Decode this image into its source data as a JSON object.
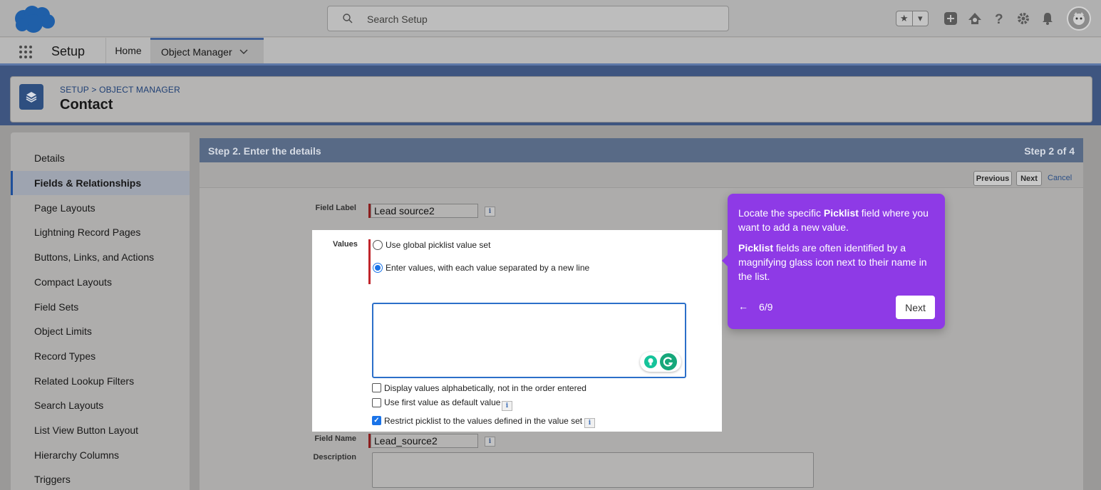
{
  "header": {
    "search_placeholder": "Search Setup",
    "star_glyph": "★",
    "dropdown_glyph": "▾"
  },
  "nav": {
    "app_name": "Setup",
    "tabs": [
      {
        "label": "Home"
      },
      {
        "label": "Object Manager"
      }
    ]
  },
  "object_header": {
    "breadcrumb": "SETUP > OBJECT MANAGER",
    "title": "Contact"
  },
  "sidebar": {
    "items": [
      {
        "label": "Details"
      },
      {
        "label": "Fields & Relationships"
      },
      {
        "label": "Page Layouts"
      },
      {
        "label": "Lightning Record Pages"
      },
      {
        "label": "Buttons, Links, and Actions"
      },
      {
        "label": "Compact Layouts"
      },
      {
        "label": "Field Sets"
      },
      {
        "label": "Object Limits"
      },
      {
        "label": "Record Types"
      },
      {
        "label": "Related Lookup Filters"
      },
      {
        "label": "Search Layouts"
      },
      {
        "label": "List View Button Layout"
      },
      {
        "label": "Hierarchy Columns"
      },
      {
        "label": "Triggers"
      }
    ],
    "active_index": 1
  },
  "step": {
    "title": "Step 2. Enter the details",
    "counter": "Step 2 of 4",
    "previous_label": "Previous",
    "next_label": "Next",
    "cancel_label": "Cancel"
  },
  "form": {
    "field_label_label": "Field Label",
    "field_label_value": "Lead source2",
    "values_label": "Values",
    "option_global": "Use global picklist value set",
    "option_enter": "Enter values, with each value separated by a new line",
    "values_text": "",
    "check_alpha": "Display values alphabetically, not in the order entered",
    "check_first_default": "Use first value as default value",
    "check_restrict": "Restrict picklist to the values defined in the value set",
    "field_name_label": "Field Name",
    "field_name_value": "Lead_source2",
    "description_label": "Description",
    "info_glyph": "i"
  },
  "tooltip": {
    "p1_pre": "Locate the specific ",
    "p1_bold": "Picklist",
    "p1_post": " field where you want to add a new value.",
    "p2_bold": "Picklist",
    "p2_post": " fields are often identified by a magnifying glass icon next to their name in the list.",
    "back_glyph": "←",
    "counter": "6/9",
    "next_label": "Next"
  },
  "colors": {
    "tooltip_bg": "#8e3ae6",
    "step_bar": "#586a86",
    "accent_blue": "#1a73e8"
  }
}
